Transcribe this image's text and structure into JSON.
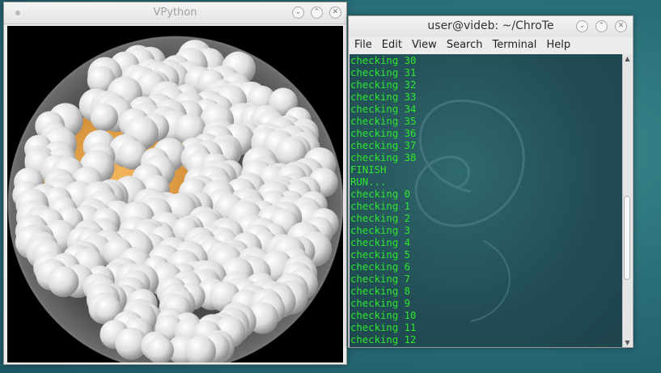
{
  "vpython": {
    "title": "VPython"
  },
  "terminal": {
    "title": "user@videb: ~/ChroTe",
    "menu": [
      "File",
      "Edit",
      "View",
      "Search",
      "Terminal",
      "Help"
    ],
    "lines": [
      "checking 30",
      "checking 31",
      "checking 32",
      "checking 33",
      "checking 34",
      "checking 35",
      "checking 36",
      "checking 37",
      "checking 38",
      "FINISH",
      "RUN...",
      "checking 0",
      "checking 1",
      "checking 2",
      "checking 3",
      "checking 4",
      "checking 5",
      "checking 6",
      "checking 7",
      "checking 8",
      "checking 9",
      "checking 10",
      "checking 11",
      "checking 12"
    ],
    "text_color": "#2ee62e"
  },
  "icons": {
    "minimize": "chevron-down-icon",
    "maximize": "chevron-up-icon",
    "close": "close-icon"
  },
  "scene": {
    "background": "#000000",
    "sphere_color": "#e8e8e8",
    "core_color": "#e8a03a"
  }
}
